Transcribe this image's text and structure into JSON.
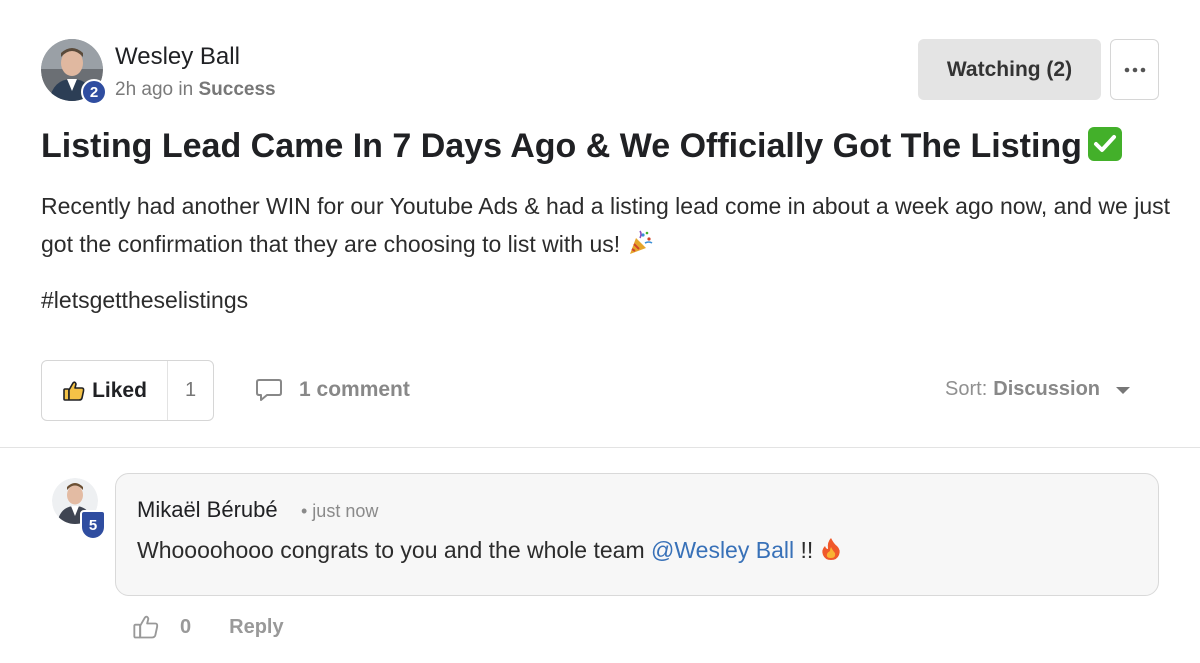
{
  "post": {
    "author": "Wesley Ball",
    "author_level": "2",
    "time": "2h ago",
    "in_word": "in",
    "category": "Success",
    "watch_label": "Watching (2)",
    "more_icon": "ellipsis-icon",
    "title": "Listing Lead Came In 7 Days Ago & We Officially Got The Listing",
    "title_emoji": "check-mark-icon",
    "body": "Recently had another WIN for our Youtube Ads & had a listing lead come in about a week ago now, and we just got the confirmation that they are choosing to list with us!",
    "body_emoji": "party-popper-icon",
    "hashtag": "#letsgettheselistings",
    "like_label": "Liked",
    "like_count": "1",
    "comment_count_label": "1 comment",
    "sort_label": "Sort:",
    "sort_value": "Discussion"
  },
  "comment": {
    "author": "Mikaël Bérubé",
    "author_level": "5",
    "time": "• just now",
    "text_prefix": "Whoooohooo congrats to you and the whole team",
    "mention": "@Wesley Ball",
    "text_suffix": "!!",
    "emoji": "fire-icon",
    "like_count": "0",
    "reply_label": "Reply"
  },
  "colors": {
    "badge": "#2f4da0",
    "mention": "#3871b8",
    "check_green": "#43b02a"
  }
}
